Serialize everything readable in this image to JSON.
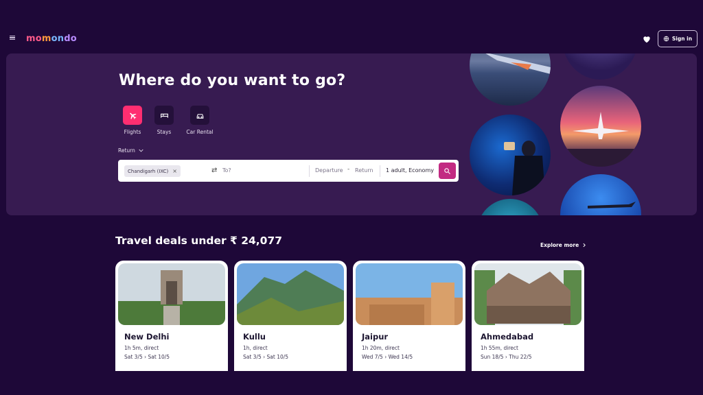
{
  "nav": {
    "logo": {
      "p1": "mo",
      "p2": "m",
      "p3": "on",
      "p4": "do"
    },
    "signin_label": "Sign in"
  },
  "hero": {
    "title": "Where do you want to go?",
    "modes": [
      {
        "label": "Flights",
        "icon": "plane-icon",
        "active": true
      },
      {
        "label": "Stays",
        "icon": "bed-icon",
        "active": false
      },
      {
        "label": "Car Rental",
        "icon": "car-icon",
        "active": false
      }
    ],
    "trip_type": "Return",
    "search": {
      "origin": "Chandigarh (IXC)",
      "destination_placeholder": "To?",
      "departure_placeholder": "Departure",
      "dash": "-",
      "return_placeholder": "Return",
      "passengers": "1 adult, Economy"
    }
  },
  "deals": {
    "title": "Travel deals under ₹ 24,077",
    "explore_label": "Explore more",
    "cards": [
      {
        "city": "New Delhi",
        "duration": "1h 5m, direct",
        "dates": "Sat 3/5 › Sat 10/5"
      },
      {
        "city": "Kullu",
        "duration": "1h, direct",
        "dates": "Sat 3/5 › Sat 10/5"
      },
      {
        "city": "Jaipur",
        "duration": "1h 20m, direct",
        "dates": "Wed 7/5 › Wed 14/5"
      },
      {
        "city": "Ahmedabad",
        "duration": "1h 55m, direct",
        "dates": "Sun 18/5 › Thu 22/5"
      }
    ]
  },
  "colors": {
    "background": "#1e0838",
    "hero": "#371b51",
    "accent": "#ff2e71",
    "search_button": "#c22a82"
  }
}
